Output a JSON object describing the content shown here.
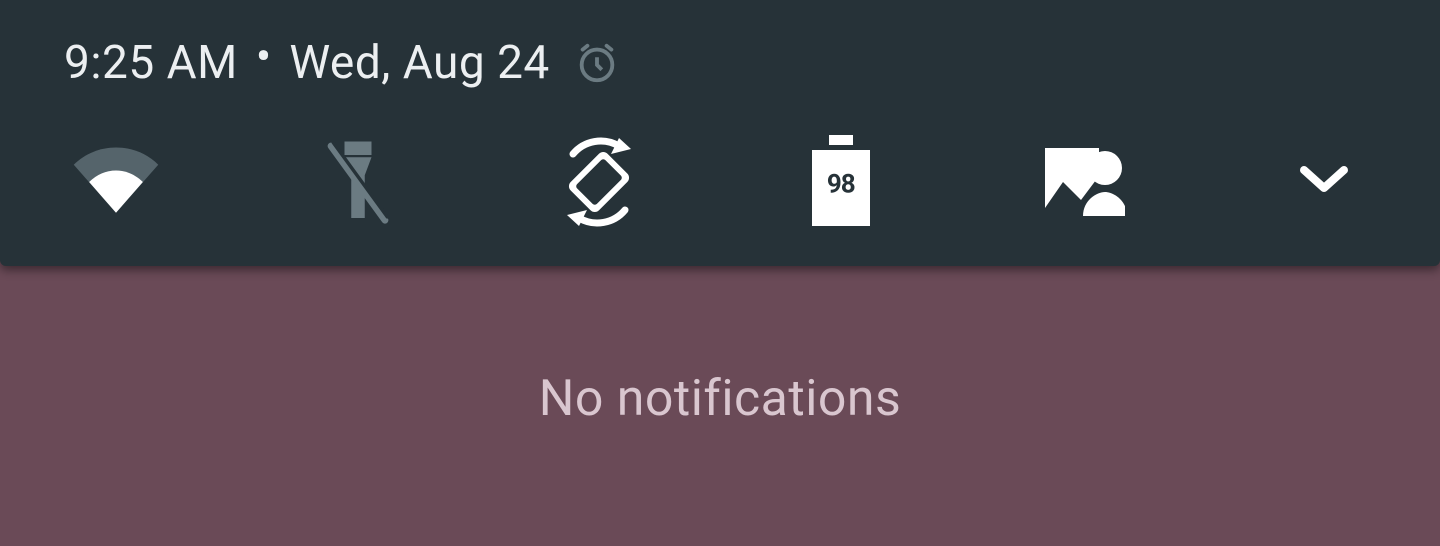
{
  "statusbar": {
    "time": "9:25 AM",
    "separator": "•",
    "date": "Wed, Aug 24",
    "alarm_set": true
  },
  "quick_settings": {
    "tiles": {
      "wifi": {
        "name": "wifi-tile",
        "icon": "wifi-icon",
        "signal_fraction": 0.55
      },
      "flashlight": {
        "name": "flashlight-tile",
        "icon": "flashlight-off-icon",
        "enabled": false
      },
      "rotation": {
        "name": "auto-rotate-tile",
        "icon": "auto-rotate-icon"
      },
      "battery": {
        "name": "battery-tile",
        "icon": "battery-icon",
        "percent": "98"
      },
      "profile": {
        "name": "user-profile-tile",
        "icon": "user-profile-icon"
      }
    },
    "expand_label": "Expand quick settings"
  },
  "notifications": {
    "empty_message": "No notifications"
  },
  "colors": {
    "panel_bg": "#263238",
    "shade_bg": "#6a4a57",
    "icon_active": "#ffffff",
    "icon_dim": "#6b7b82"
  }
}
